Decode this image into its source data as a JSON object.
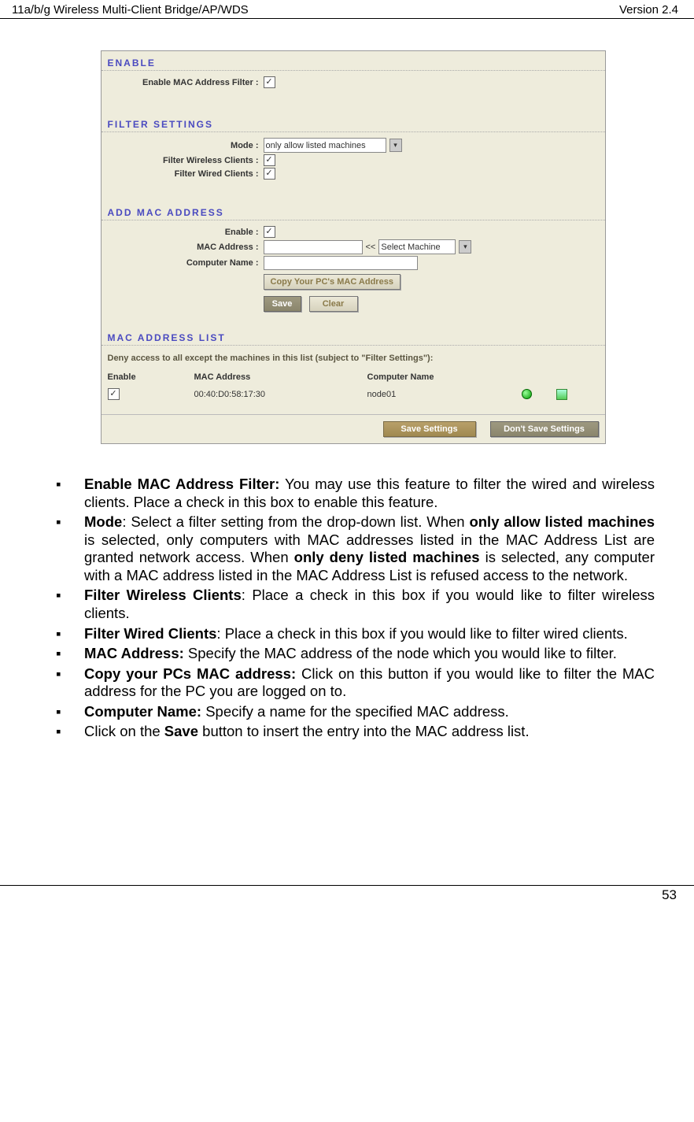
{
  "header": {
    "left": "11a/b/g Wireless Multi-Client Bridge/AP/WDS",
    "right": "Version 2.4"
  },
  "panel": {
    "enable": {
      "title": "ENABLE",
      "label": "Enable MAC Address Filter :",
      "checked": "✓"
    },
    "filter": {
      "title": "FILTER SETTINGS",
      "mode_label": "Mode :",
      "mode_value": "only allow listed machines",
      "wireless_label": "Filter Wireless Clients :",
      "wireless_checked": "✓",
      "wired_label": "Filter Wired Clients :",
      "wired_checked": "✓"
    },
    "add": {
      "title": "ADD MAC ADDRESS",
      "enable_label": "Enable :",
      "enable_checked": "✓",
      "mac_label": "MAC Address :",
      "mac_gap": "<<",
      "select_machine": "Select Machine",
      "computer_label": "Computer Name :",
      "copy_btn": "Copy Your PC's MAC Address",
      "save_btn": "Save",
      "clear_btn": "Clear"
    },
    "list": {
      "title": "MAC ADDRESS LIST",
      "note": "Deny access to all except the machines in this list (subject to \"Filter Settings\"):",
      "head_enable": "Enable",
      "head_mac": "MAC Address",
      "head_name": "Computer Name",
      "row_checked": "✓",
      "row_mac": "00:40:D0:58:17:30",
      "row_name": "node01"
    },
    "footer": {
      "save": "Save Settings",
      "dont": "Don't Save Settings"
    }
  },
  "desc": {
    "items": [
      {
        "pre": "Enable MAC Address Filter:",
        "post": " You may use this feature to filter the wired and wireless clients. Place a check in this box to enable this feature."
      },
      {
        "pre": "Mode",
        "post": ": Select a filter setting from the drop-down list. When ",
        "b2": "only allow listed machines",
        "post2": " is selected, only computers with MAC addresses listed in the MAC Address List are granted network access. When ",
        "b3": "only deny listed machines",
        "post3": " is selected, any computer with a MAC address listed in the MAC Address List is refused access to the network."
      },
      {
        "pre": "Filter Wireless Clients",
        "post": ": Place a check in this box if you would like to filter wireless clients."
      },
      {
        "pre": "Filter Wired Clients",
        "post": ": Place a check in this box if you would like to filter wired clients."
      },
      {
        "pre": "MAC Address:",
        "post": " Specify the MAC address of the node which you would like to filter."
      },
      {
        "pre": "Copy your PCs MAC address:",
        "post": " Click on this button if you would like to filter the MAC address for the PC you are logged on to."
      },
      {
        "pre": "Computer Name:",
        "post": " Specify a name for the specified MAC address."
      },
      {
        "pre": "",
        "post": "Click on the ",
        "b2": "Save",
        "post2": " button to insert the entry into the MAC address list."
      }
    ]
  },
  "page_number": "53"
}
